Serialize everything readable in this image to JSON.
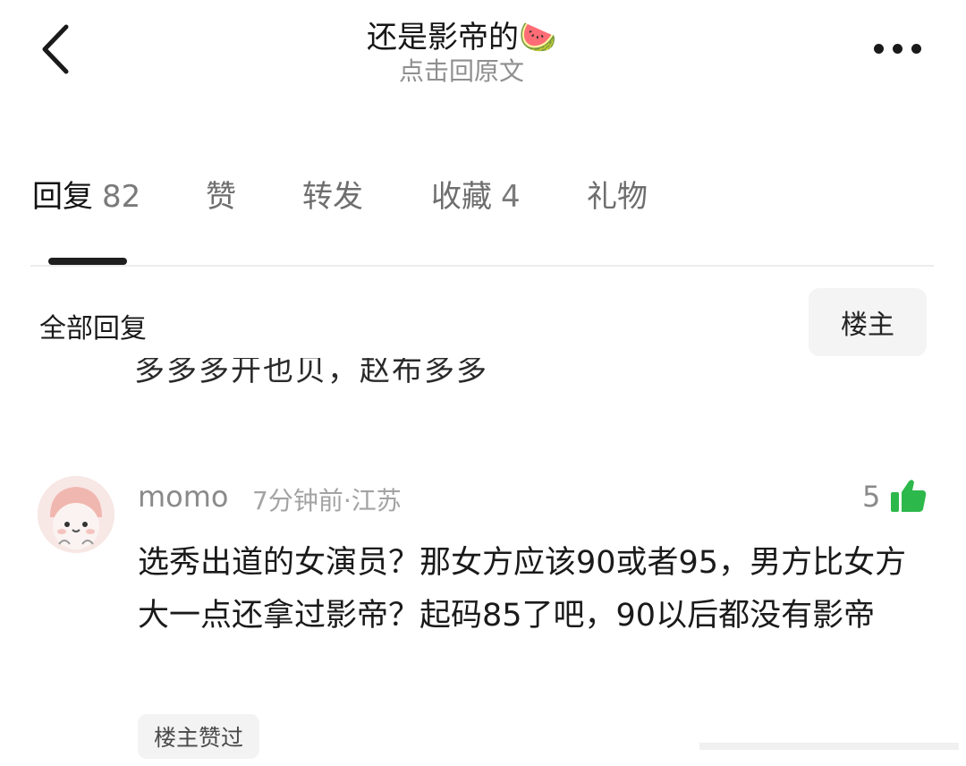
{
  "header": {
    "title": "还是影帝的🍉",
    "subtitle": "点击回原文"
  },
  "tabs": [
    {
      "label": "回复",
      "count": "82",
      "active": true
    },
    {
      "label": "赞",
      "count": "",
      "active": false
    },
    {
      "label": "转发",
      "count": "",
      "active": false
    },
    {
      "label": "收藏",
      "count": "4",
      "active": false
    },
    {
      "label": "礼物",
      "count": "",
      "active": false
    }
  ],
  "filter": {
    "all_label": "全部回复",
    "owner_label": "楼主"
  },
  "previous_comment_fragment": "多多多开也贝，赵布多多",
  "comment": {
    "username": "momo",
    "meta": "7分钟前·江苏",
    "like_count": "5",
    "text": "选秀出道的女演员？那女方应该90或者95，男方比女方大一点还拿过影帝？起码85了吧，90以后都没有影帝",
    "badge": "楼主赞过"
  },
  "colors": {
    "like_green": "#2db84b",
    "accent_dark": "#1e1e1e"
  }
}
